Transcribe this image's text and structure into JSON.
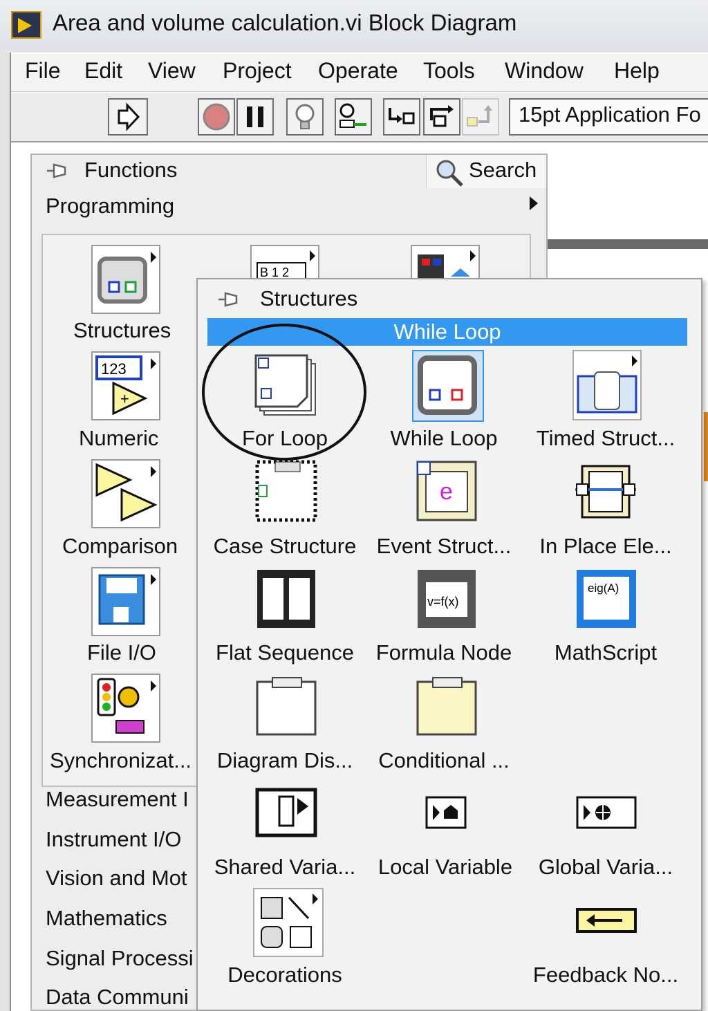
{
  "window": {
    "title": "Area and volume calculation.vi Block Diagram"
  },
  "menu": [
    "File",
    "Edit",
    "View",
    "Project",
    "Operate",
    "Tools",
    "Window",
    "Help"
  ],
  "toolbar": {
    "font_select": "15pt Application Fo"
  },
  "palette": {
    "title": "Functions",
    "search_label": "Search",
    "section": "Programming",
    "categories": [
      "Structures",
      "Numeric",
      "Comparison",
      "File I/O",
      "Synchronizat..."
    ],
    "list": [
      "Measurement I",
      "Instrument I/O",
      "Vision and Mot",
      "Mathematics",
      "Signal Processi",
      "Data Communi"
    ],
    "partial_icons": {
      "array_text": "B 1 2",
      "numeric_text": "123"
    }
  },
  "subpalette": {
    "title": "Structures",
    "tooltip": "While Loop",
    "items": [
      "For Loop",
      "While Loop",
      "Timed Struct...",
      "Case Structure",
      "Event Struct...",
      "In Place Ele...",
      "Flat Sequence",
      "Formula Node",
      "MathScript",
      "Diagram Dis...",
      "Conditional ...",
      "",
      "Shared Varia...",
      "Local Variable",
      "Global Varia...",
      "Decorations",
      "",
      "Feedback No..."
    ],
    "icon_text": {
      "formula": "v=f(x)",
      "mathscript": "eig(A)",
      "event": "e"
    }
  }
}
